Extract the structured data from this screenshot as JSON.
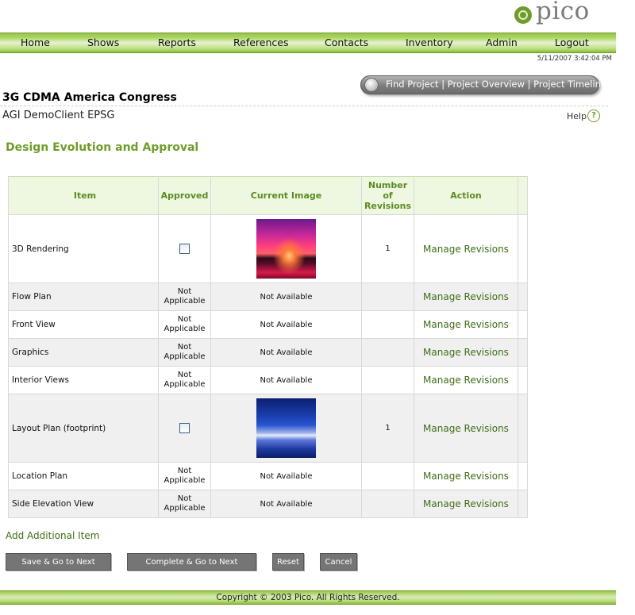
{
  "logo": {
    "text": "pico",
    "icon": "pico-leaf-icon"
  },
  "nav": {
    "items": [
      "Home",
      "Shows",
      "Reports",
      "References",
      "Contacts",
      "Inventory",
      "Admin",
      "Logout"
    ]
  },
  "timestamp": "5/11/2007 3:42:04 PM",
  "project_toolbar": {
    "links": [
      "Find Project",
      "Project Overview",
      "Project Timeline"
    ],
    "separator": " | "
  },
  "project": {
    "title": "3G CDMA America Congress",
    "client": "AGI DemoClient EPSG"
  },
  "help": {
    "label": "Help",
    "icon": "help-question-icon",
    "glyph": "?"
  },
  "section_title": "Design Evolution and Approval",
  "table": {
    "headers": {
      "item": "Item",
      "approved": "Approved",
      "current_image": "Current Image",
      "revisions_line1": "Number",
      "revisions_line2": "of",
      "revisions_line3": "Revisions",
      "action": "Action"
    },
    "rows": [
      {
        "item": "3D Rendering",
        "approved": "checkbox",
        "approved_checked": false,
        "image": "sunset-thumbnail",
        "revisions": "1",
        "action": "Manage Revisions"
      },
      {
        "item": "Flow Plan",
        "approved_l1": "Not",
        "approved_l2": "Applicable",
        "image_text": "Not Available",
        "revisions": "",
        "action": "Manage Revisions"
      },
      {
        "item": "Front View",
        "approved_l1": "Not",
        "approved_l2": "Applicable",
        "image_text": "Not Available",
        "revisions": "",
        "action": "Manage Revisions"
      },
      {
        "item": "Graphics",
        "approved_l1": "Not",
        "approved_l2": "Applicable",
        "image_text": "Not Available",
        "revisions": "",
        "action": "Manage Revisions"
      },
      {
        "item": "Interior Views",
        "approved_l1": "Not",
        "approved_l2": "Applicable",
        "image_text": "Not Available",
        "revisions": "",
        "action": "Manage Revisions"
      },
      {
        "item": "Layout Plan (footprint)",
        "approved": "checkbox",
        "approved_checked": false,
        "image": "blue-water-thumbnail",
        "revisions": "1",
        "action": "Manage Revisions"
      },
      {
        "item": "Location Plan",
        "approved_l1": "Not",
        "approved_l2": "Applicable",
        "image_text": "Not Available",
        "revisions": "",
        "action": "Manage Revisions"
      },
      {
        "item": "Side Elevation View",
        "approved_l1": "Not",
        "approved_l2": "Applicable",
        "image_text": "Not Available",
        "revisions": "",
        "action": "Manage Revisions"
      }
    ]
  },
  "add_item_link": "Add Additional Item",
  "buttons": {
    "save_next": "Save & Go to Next",
    "complete_next": "Complete & Go to Next",
    "reset": "Reset",
    "cancel": "Cancel"
  },
  "footer": {
    "copyright": "Copyright © 2003 Pico. All Rights Reserved."
  },
  "colors": {
    "brand_green": "#6f9c2b",
    "link_green": "#3e6e17",
    "button_gray": "#757575"
  }
}
